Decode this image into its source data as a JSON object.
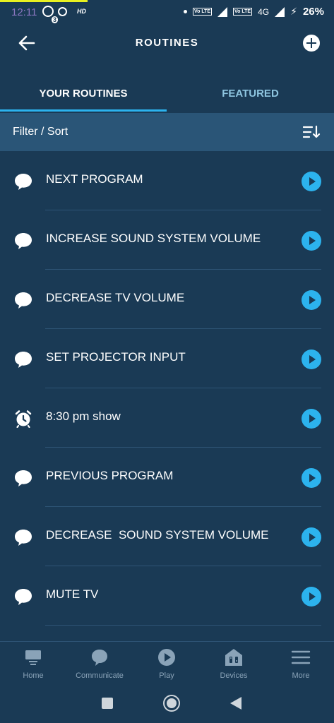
{
  "status_bar": {
    "time": "12:11",
    "notification_count": "3",
    "hd_label": "HD",
    "volte_label_1": "Vo LTE",
    "volte_label_2": "Vo LTE",
    "network": "4G",
    "battery": "26%"
  },
  "app_bar": {
    "title": "ROUTINES"
  },
  "tabs": [
    {
      "label": "YOUR ROUTINES",
      "selected": true
    },
    {
      "label": "FEATURED",
      "selected": false
    }
  ],
  "filter": {
    "label": "Filter / Sort"
  },
  "routines": [
    {
      "label": "NEXT PROGRAM",
      "icon": "speech-bubble-icon"
    },
    {
      "label": "INCREASE SOUND SYSTEM VOLUME",
      "icon": "speech-bubble-icon"
    },
    {
      "label": "DECREASE TV VOLUME",
      "icon": "speech-bubble-icon"
    },
    {
      "label": "SET PROJECTOR INPUT",
      "icon": "speech-bubble-icon"
    },
    {
      "label": "8:30 pm show",
      "icon": "alarm-clock-icon"
    },
    {
      "label": "PREVIOUS PROGRAM",
      "icon": "speech-bubble-icon"
    },
    {
      "label": "DECREASE  SOUND SYSTEM VOLUME",
      "icon": "speech-bubble-icon"
    },
    {
      "label": "MUTE TV",
      "icon": "speech-bubble-icon"
    }
  ],
  "bottom_nav": [
    {
      "label": "Home",
      "icon": "home-icon"
    },
    {
      "label": "Communicate",
      "icon": "communicate-icon"
    },
    {
      "label": "Play",
      "icon": "play-icon"
    },
    {
      "label": "Devices",
      "icon": "devices-icon"
    },
    {
      "label": "More",
      "icon": "menu-icon"
    }
  ],
  "colors": {
    "background": "#1a3a55",
    "filter_bar": "#2a5577",
    "accent": "#2cb3ee",
    "inactive_tab": "#8ec5e0",
    "nav_inactive": "#8aa3b8"
  }
}
